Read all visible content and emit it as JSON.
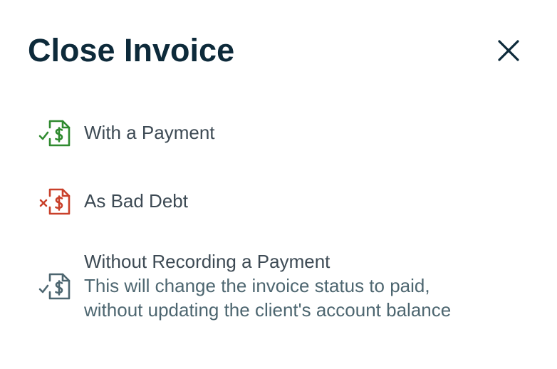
{
  "dialog": {
    "title": "Close Invoice",
    "close_icon": "close-icon"
  },
  "options": [
    {
      "label": "With a Payment",
      "icon": "invoice-check-dollar-icon",
      "color": "#2f8a2f"
    },
    {
      "label": "As Bad Debt",
      "icon": "invoice-x-dollar-icon",
      "color": "#c9402a"
    },
    {
      "label": "Without Recording a Payment",
      "description_line1": "This will change the invoice status to paid,",
      "description_line2": "without updating the client's account balance",
      "icon": "invoice-check-dollar-icon",
      "color": "#4d6670"
    }
  ]
}
